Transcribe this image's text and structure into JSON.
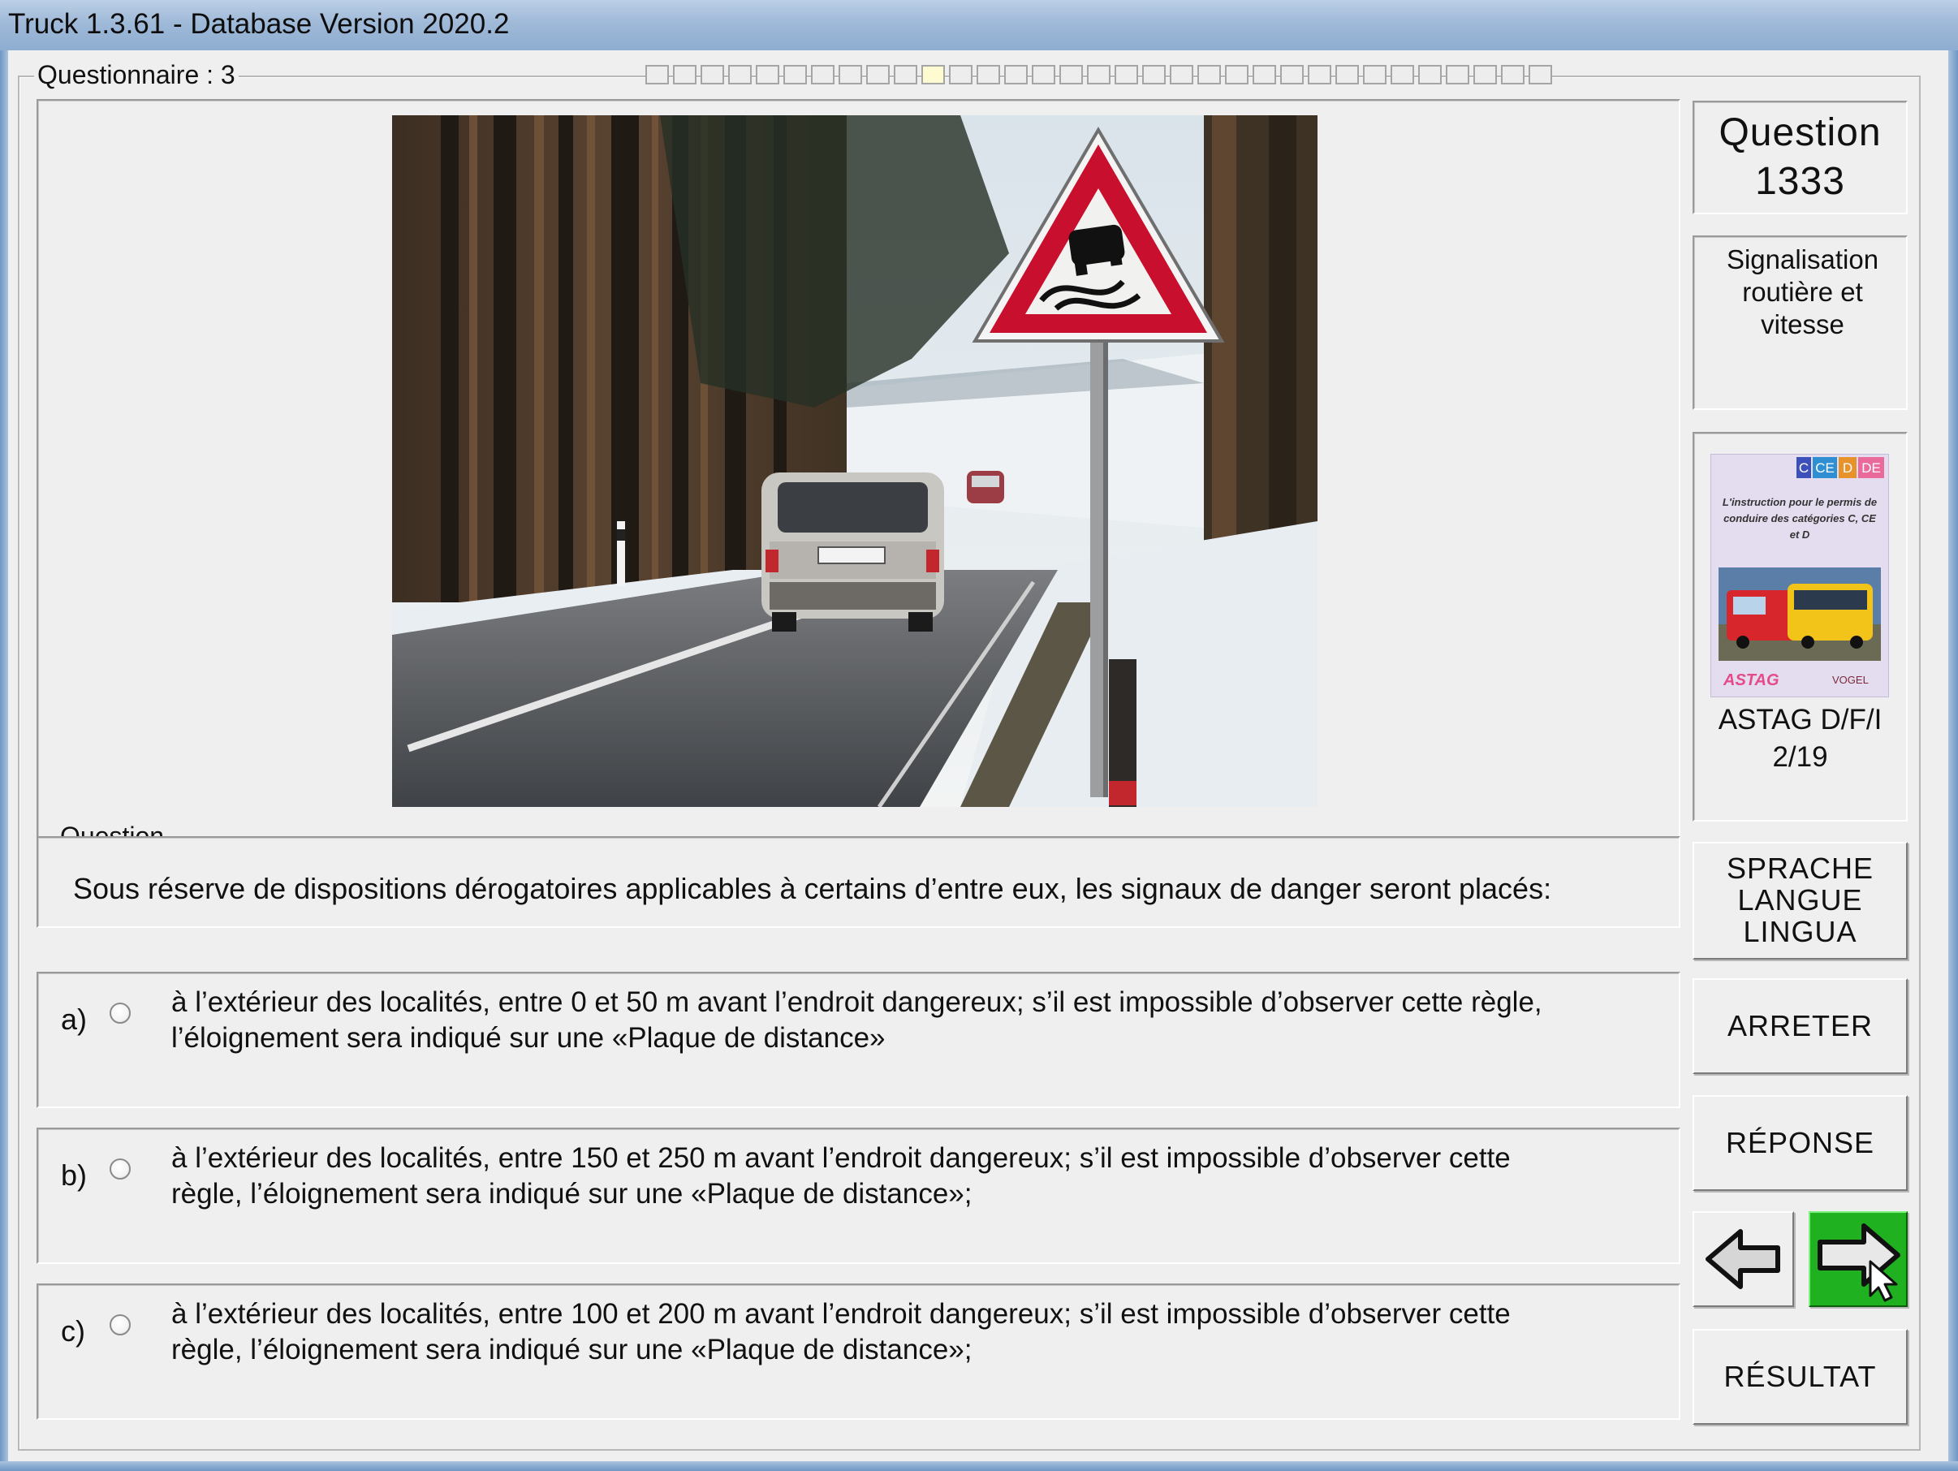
{
  "window": {
    "title": "Truck 1.3.61 - Database Version 2020.2"
  },
  "questionnaire": {
    "label": "Questionnaire : 3",
    "progress_total": 33,
    "progress_current_index": 10
  },
  "question_header": {
    "label": "Question",
    "number": "1333"
  },
  "category": {
    "text": "Signalisation routière et vitesse"
  },
  "book": {
    "badges": [
      "C",
      "CE",
      "D",
      "DE"
    ],
    "cover_text": "L'instruction pour le permis de conduire des catégories C, CE et D",
    "logo_left": "ASTAG",
    "logo_right": "VOGEL",
    "caption_line1": "ASTAG D/F/I",
    "caption_line2": "2/19"
  },
  "question": {
    "legend": "Question",
    "text": "Sous réserve de dispositions dérogatoires applicables à certains d’entre eux, les signaux de danger seront placés:"
  },
  "answers": [
    {
      "letter": "a)",
      "line1": "à l’extérieur des localités, entre 0 et 50 m avant l’endroit dangereux; s’il est impossible d’observer cette règle,",
      "line2": "l’éloignement sera indiqué sur une «Plaque de distance»"
    },
    {
      "letter": "b)",
      "line1": "à l’extérieur des localités, entre 150 et 250 m avant l’endroit dangereux; s’il est impossible d’observer cette",
      "line2": "règle, l’éloignement sera indiqué sur une «Plaque de distance»;"
    },
    {
      "letter": "c)",
      "line1": "à l’extérieur des localités, entre 100 et 200 m avant l’endroit dangereux; s’il est impossible d’observer cette",
      "line2": "règle, l’éloignement sera indiqué sur une «Plaque de distance»;"
    }
  ],
  "buttons": {
    "language_l1": "SPRACHE",
    "language_l2": "LANGUE",
    "language_l3": "LINGUA",
    "stop": "ARRETER",
    "answer": "RÉPONSE",
    "result": "RÉSULTAT"
  },
  "colors": {
    "next_button": "#1fb11f",
    "sign_red": "#c8102e"
  }
}
